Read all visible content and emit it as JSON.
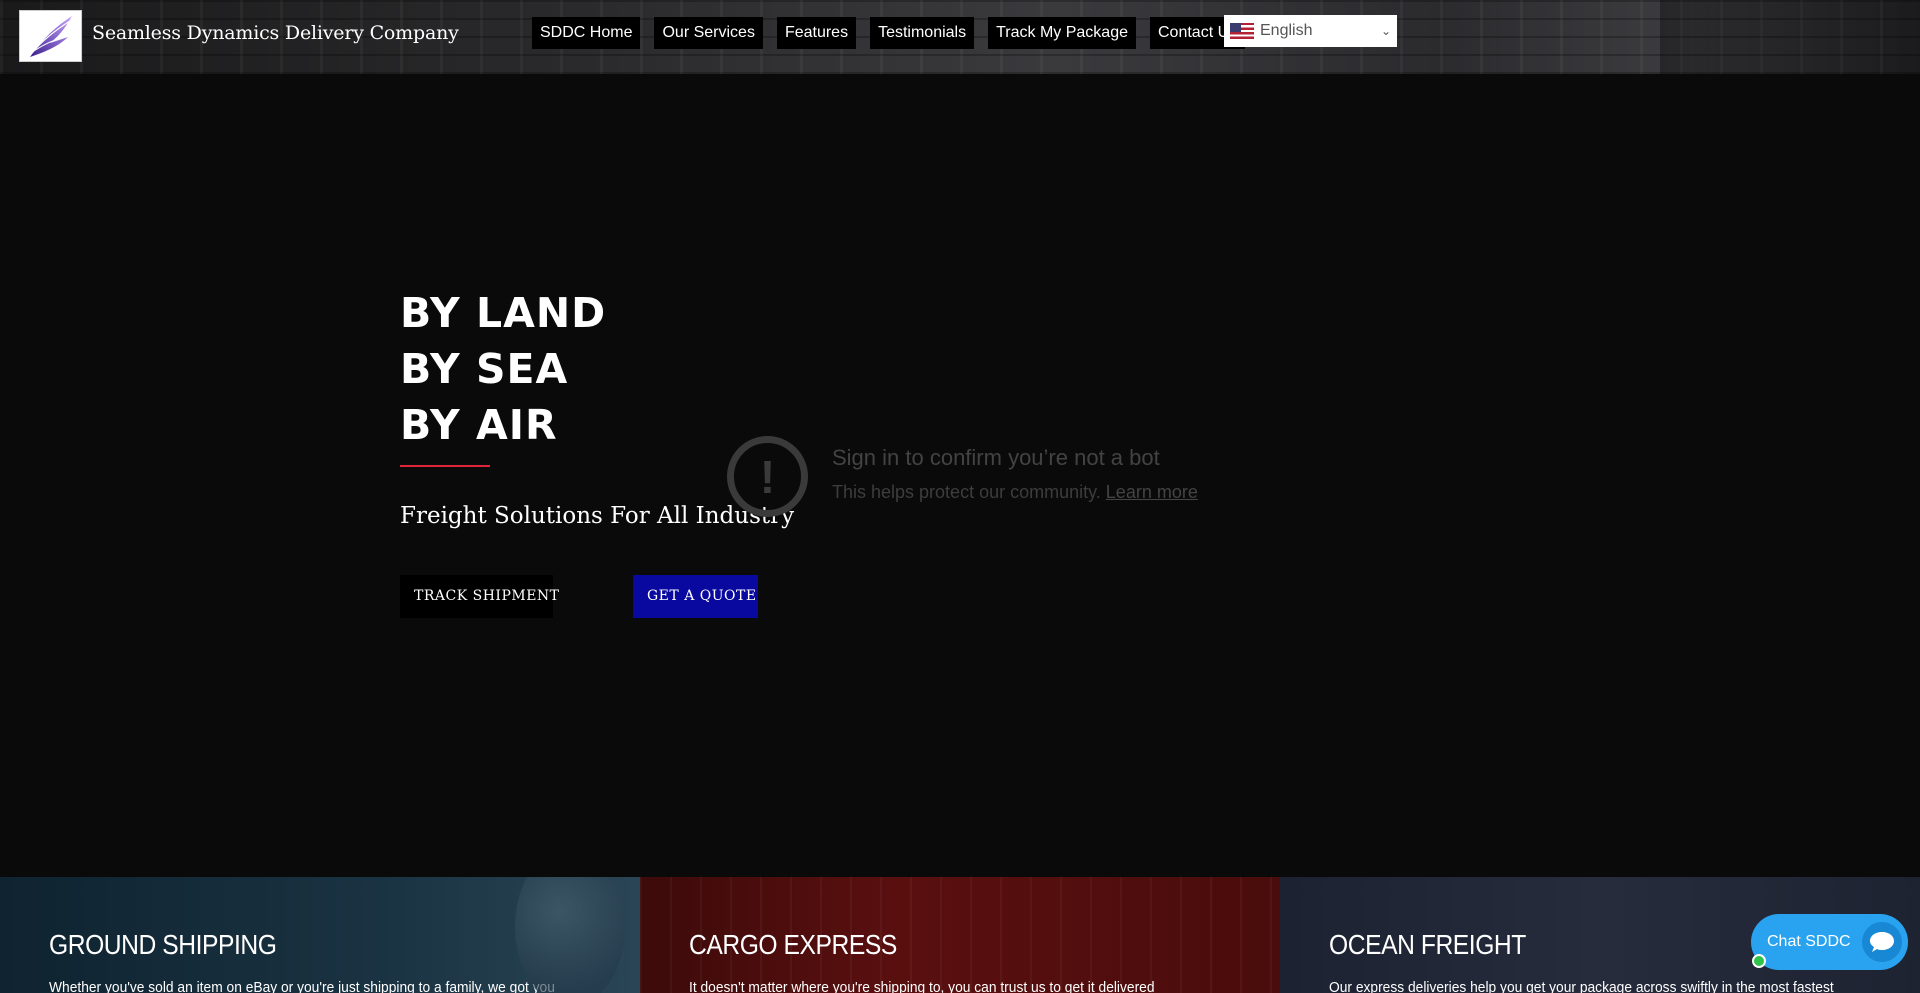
{
  "header": {
    "brand": "Seamless Dynamics Delivery Company",
    "logo_icon": "feather-wing-icon",
    "nav": [
      {
        "label": "SDDC Home"
      },
      {
        "label": "Our Services"
      },
      {
        "label": "Features"
      },
      {
        "label": "Testimonials"
      },
      {
        "label": "Track My Package"
      },
      {
        "label": "Contact Us"
      }
    ],
    "language": {
      "selected": "English",
      "flag_icon": "us-flag-icon"
    }
  },
  "hero": {
    "lines": [
      "BY LAND",
      "BY SEA",
      "BY AIR"
    ],
    "subtitle": "Freight Solutions For All Industry",
    "track_button": "TRACK SHIPMENT",
    "quote_button": "GET A QUOTE",
    "accent_color": "#e0243b",
    "quote_button_color": "#0909a0"
  },
  "bot_check": {
    "title": "Sign in to confirm you’re not a bot",
    "text": "This helps protect our community.",
    "link": "Learn more",
    "icon": "exclamation-circle-icon"
  },
  "services": [
    {
      "title": "GROUND SHIPPING",
      "text": "Whether you've sold an item on eBay or you're just shipping to a family, we got you"
    },
    {
      "title": "CARGO EXPRESS",
      "text": "It doesn't matter where you're shipping to, you can trust us to get it delivered"
    },
    {
      "title": "OCEAN FREIGHT",
      "text": "Our express deliveries help you get your package across swiftly in the most fastest"
    }
  ],
  "chat": {
    "label": "Chat SDDC",
    "icon": "chat-bubble-icon",
    "color": "#29a3ef"
  }
}
